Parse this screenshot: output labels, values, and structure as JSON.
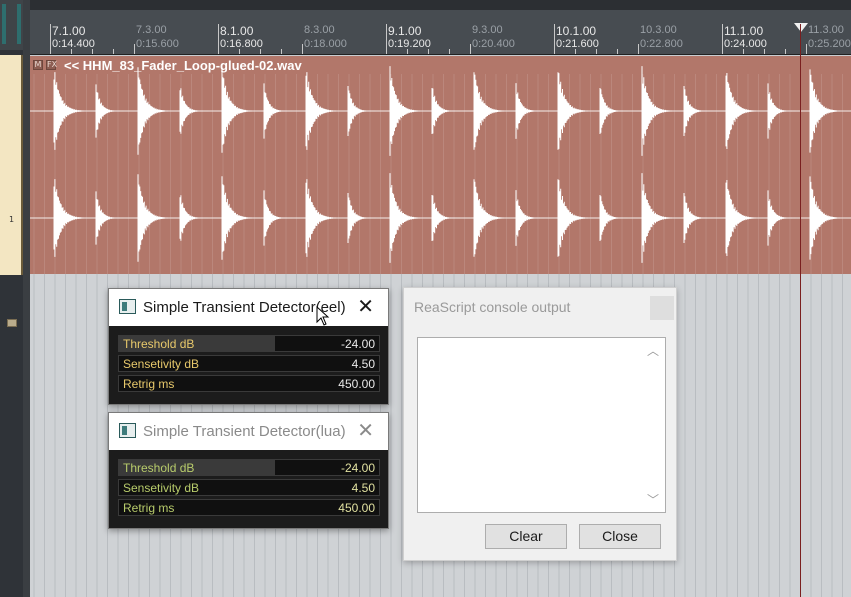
{
  "ruler": {
    "marks": [
      {
        "bar": "7.1.00",
        "time": "0:14.400",
        "major": true
      },
      {
        "bar": "7.3.00",
        "time": "0:15.600",
        "major": false
      },
      {
        "bar": "8.1.00",
        "time": "0:16.800",
        "major": true
      },
      {
        "bar": "8.3.00",
        "time": "0:18.000",
        "major": false
      },
      {
        "bar": "9.1.00",
        "time": "0:19.200",
        "major": true
      },
      {
        "bar": "9.3.00",
        "time": "0:20.400",
        "major": false
      },
      {
        "bar": "10.1.00",
        "time": "0:21.600",
        "major": true
      },
      {
        "bar": "10.3.00",
        "time": "0:22.800",
        "major": false
      },
      {
        "bar": "11.1.00",
        "time": "0:24.000",
        "major": true
      },
      {
        "bar": "11.3.00",
        "time": "0:25.200",
        "major": false
      }
    ]
  },
  "track": {
    "number": "1"
  },
  "item": {
    "mute_label": "M",
    "fx_label": "FX",
    "name": "<< HHM_83_Fader_Loop-glued-02.wav",
    "color": "#b2776a"
  },
  "fx_eel": {
    "title": "Simple Transient Detector(eel)",
    "close": "✕",
    "params": [
      {
        "label": "Threshold dB",
        "value": "-24.00",
        "fill": 0.6
      },
      {
        "label": "Sensetivity dB",
        "value": "4.50",
        "fill": 0.0
      },
      {
        "label": "Retrig ms",
        "value": "450.00",
        "fill": 0.0
      }
    ]
  },
  "fx_lua": {
    "title": "Simple Transient Detector(lua)",
    "close": "✕",
    "params": [
      {
        "label": "Threshold dB",
        "value": "-24.00",
        "fill": 0.6
      },
      {
        "label": "Sensetivity dB",
        "value": "4.50",
        "fill": 0.0
      },
      {
        "label": "Retrig ms",
        "value": "450.00",
        "fill": 0.0
      }
    ]
  },
  "console": {
    "title": "ReaScript console output",
    "clear_label": "Clear",
    "close_label": "Close",
    "output_text": ""
  }
}
